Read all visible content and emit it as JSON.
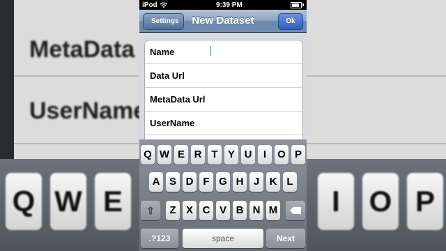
{
  "status_bar": {
    "carrier": "iPod",
    "time": "9:39 PM",
    "wifi_icon": "wifi-icon",
    "battery_icon": "battery-icon"
  },
  "nav": {
    "back_label": "Settings",
    "title": "New Dataset",
    "ok_label": "Ok"
  },
  "form": {
    "rows": [
      {
        "label": "Name"
      },
      {
        "label": "Data Url"
      },
      {
        "label": "MetaData Url"
      },
      {
        "label": "UserName"
      }
    ]
  },
  "keyboard": {
    "row1": [
      "Q",
      "W",
      "E",
      "R",
      "T",
      "Y",
      "U",
      "I",
      "O",
      "P"
    ],
    "row2": [
      "A",
      "S",
      "D",
      "F",
      "G",
      "H",
      "J",
      "K",
      "L"
    ],
    "row3": [
      "Z",
      "X",
      "C",
      "V",
      "B",
      "N",
      "M"
    ],
    "mode_label": ".?123",
    "space_label": "space",
    "next_label": "Next",
    "shift_icon": "shift-icon",
    "delete_icon": "delete-icon"
  },
  "background": {
    "text_1": "MetaData",
    "text_2": "UserName",
    "keys_left": [
      "Q",
      "W",
      "E"
    ],
    "keys_right": [
      "I",
      "O",
      "P"
    ]
  }
}
